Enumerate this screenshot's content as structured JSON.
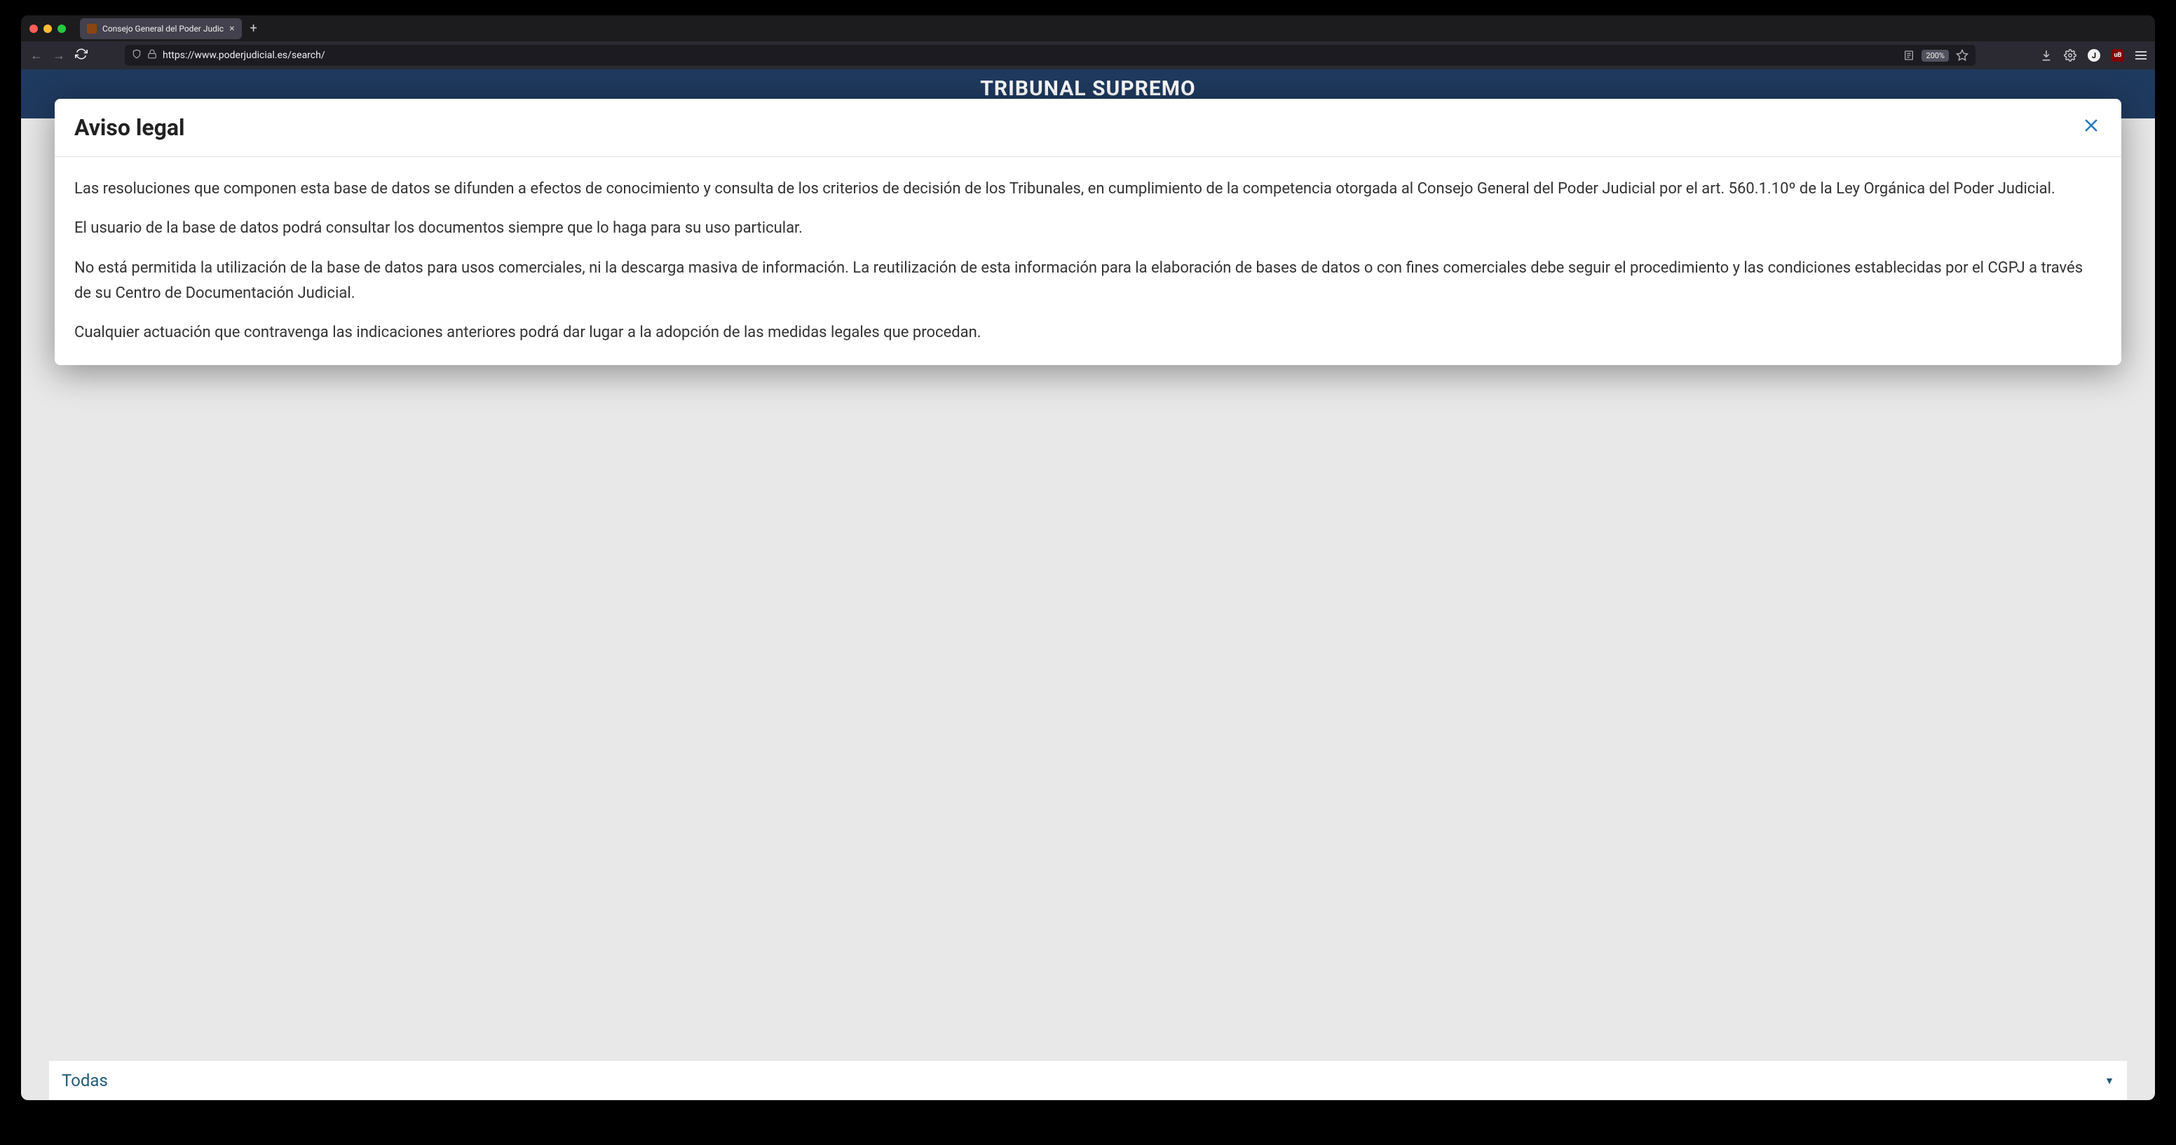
{
  "browser": {
    "tab_title": "Consejo General del Poder Judic",
    "url": "https://www.poderjudicial.es/search/",
    "zoom": "200%",
    "profile_letter": "J",
    "ublock_label": "uB"
  },
  "page": {
    "header_title": "TRIBUNAL SUPREMO",
    "dropdown_label": "Todas"
  },
  "modal": {
    "title": "Aviso legal",
    "close_symbol": "✕",
    "paragraphs": [
      "Las resoluciones que componen esta base de datos se difunden a efectos de conocimiento y consulta de los criterios de decisión de los Tribunales, en cumplimiento de la competencia otorgada al Consejo General del Poder Judicial por el art. 560.1.10º de la Ley Orgánica del Poder Judicial.",
      "El usuario de la base de datos podrá consultar los documentos siempre que lo haga para su uso particular.",
      "No está permitida la utilización de la base de datos para usos comerciales, ni la descarga masiva de información. La reutilización de esta información para la elaboración de bases de datos o con fines comerciales debe seguir el procedimiento y las condiciones establecidas por el CGPJ a través de su Centro de Documentación Judicial.",
      "Cualquier actuación que contravenga las indicaciones anteriores podrá dar lugar a la adopción de las medidas legales que procedan."
    ]
  }
}
